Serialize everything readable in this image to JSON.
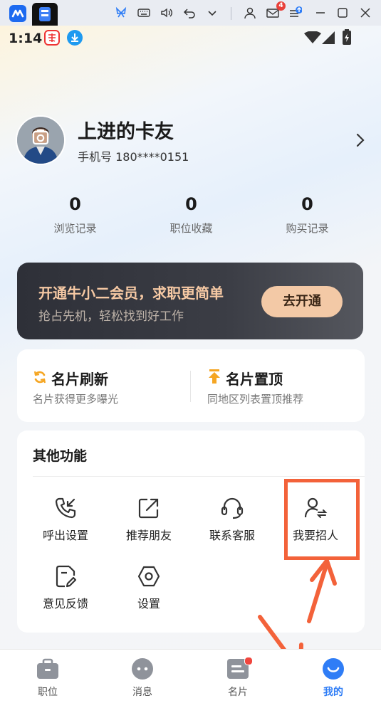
{
  "host_bar": {
    "mail_badge": "4",
    "icons": [
      "app-icon",
      "tab-icon",
      "butterfly-icon",
      "keyboard-icon",
      "volume-icon",
      "undo-icon",
      "chevron-down-icon",
      "user-icon",
      "mail-icon",
      "menu-update-icon",
      "minimize-icon",
      "maximize-icon",
      "close-icon"
    ]
  },
  "status_bar": {
    "time": "1:14",
    "icons": [
      "app-notification-icon",
      "download-icon",
      "wifi-icon",
      "signal-icon",
      "battery-icon"
    ]
  },
  "profile": {
    "name": "上进的卡友",
    "phone": "手机号 180****0151",
    "stats": [
      {
        "value": "0",
        "label": "浏览记录"
      },
      {
        "value": "0",
        "label": "职位收藏"
      },
      {
        "value": "0",
        "label": "购买记录"
      }
    ]
  },
  "vip_banner": {
    "title": "开通牛小二会员，求职更简单",
    "subtitle": "抢占先机，轻松找到好工作",
    "button": "去开通"
  },
  "card_tools": [
    {
      "title": "名片刷新",
      "desc": "名片获得更多曝光",
      "icon": "refresh-icon"
    },
    {
      "title": "名片置顶",
      "desc": "同地区列表置顶推荐",
      "icon": "pin-top-icon"
    }
  ],
  "other_functions": {
    "title": "其他功能",
    "items": [
      {
        "label": "呼出设置",
        "icon": "phone-call-icon"
      },
      {
        "label": "推荐朋友",
        "icon": "share-icon"
      },
      {
        "label": "联系客服",
        "icon": "headset-icon"
      },
      {
        "label": "我要招人",
        "icon": "recruit-icon"
      },
      {
        "label": "意见反馈",
        "icon": "feedback-icon"
      },
      {
        "label": "设置",
        "icon": "gear-icon"
      }
    ]
  },
  "bottom_nav": [
    {
      "label": "职位",
      "icon": "briefcase-icon",
      "active": false
    },
    {
      "label": "消息",
      "icon": "chat-icon",
      "active": false
    },
    {
      "label": "名片",
      "icon": "card-icon",
      "active": false
    },
    {
      "label": "我的",
      "icon": "smile-icon",
      "active": true
    }
  ],
  "colors": {
    "accent": "#2f7df6",
    "annotation": "#f3623a",
    "vip_gold": "#f6c9a4"
  }
}
